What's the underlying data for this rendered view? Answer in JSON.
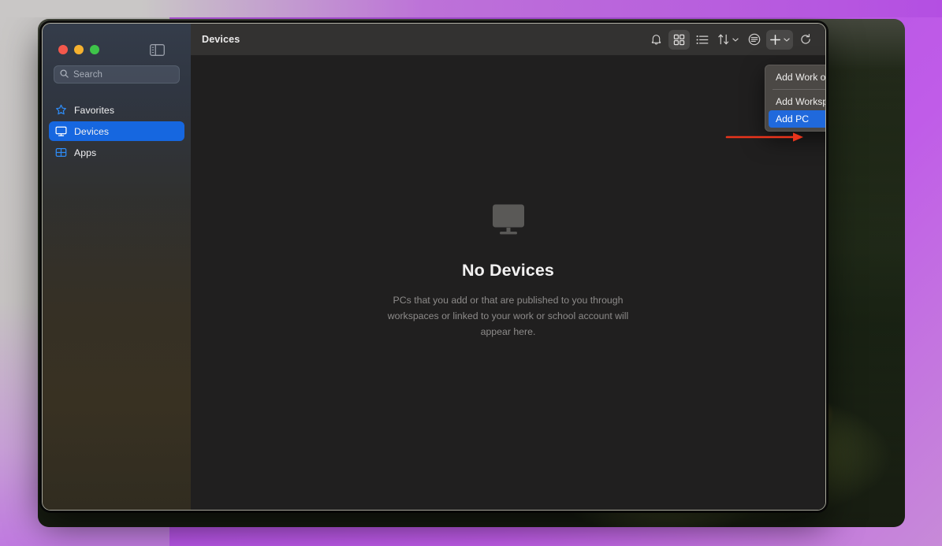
{
  "window": {
    "traffic_lights": [
      "close",
      "minimize",
      "zoom"
    ],
    "sidebar_toggle_label": "Toggle Sidebar"
  },
  "sidebar": {
    "search": {
      "placeholder": "Search",
      "value": ""
    },
    "items": [
      {
        "label": "Favorites",
        "icon": "star-icon",
        "active": false
      },
      {
        "label": "Devices",
        "icon": "display-icon",
        "active": true
      },
      {
        "label": "Apps",
        "icon": "grid-apps-icon",
        "active": false
      }
    ]
  },
  "toolbar": {
    "title": "Devices",
    "actions": [
      {
        "name": "notifications-button",
        "icon": "bell-icon",
        "selected": false
      },
      {
        "name": "grid-view-button",
        "icon": "grid-view-icon",
        "selected": true
      },
      {
        "name": "list-view-button",
        "icon": "list-view-icon",
        "selected": false
      },
      {
        "name": "sort-button",
        "icon": "sort-arrows-icon",
        "selected": false,
        "has_chevron": true
      },
      {
        "name": "filter-button",
        "icon": "filter-circle-icon",
        "selected": false
      },
      {
        "name": "add-button",
        "icon": "plus-icon",
        "selected": true,
        "has_chevron": true
      },
      {
        "name": "refresh-button",
        "icon": "refresh-icon",
        "selected": false
      }
    ]
  },
  "empty_state": {
    "icon": "display-icon",
    "title": "No Devices",
    "description": "PCs that you add or that are published to you through workspaces or linked to your work or school account will appear here."
  },
  "add_menu": {
    "items": [
      {
        "label": "Add Work or School Account",
        "highlighted": false
      },
      {
        "separator": true
      },
      {
        "label": "Add Workspace",
        "highlighted": false
      },
      {
        "label": "Add PC",
        "highlighted": true
      }
    ]
  },
  "annotation": {
    "arrow_color": "#e8341c",
    "points_to": "Add PC"
  },
  "colors": {
    "accent_blue": "#1667e0",
    "menu_highlight": "#2069dc",
    "toolbar_bg": "#333231",
    "content_bg": "#201f1f",
    "menu_bg": "#4b4845"
  }
}
